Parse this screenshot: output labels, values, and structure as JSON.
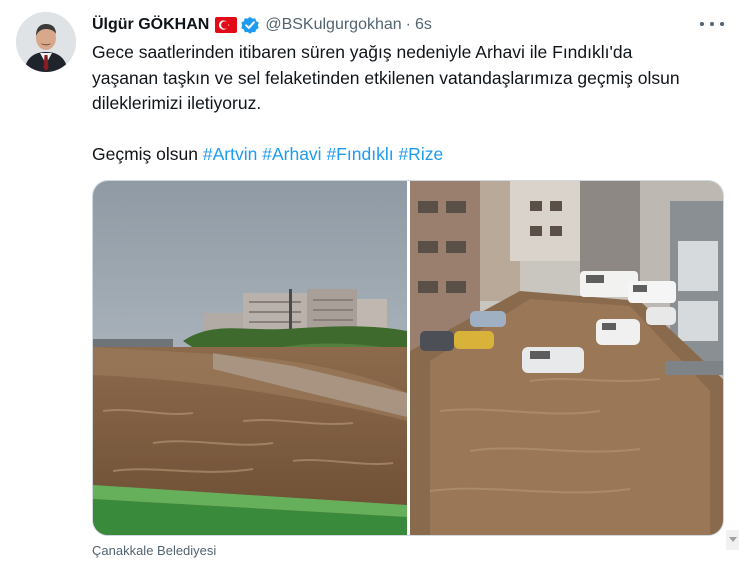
{
  "author": {
    "display_name": "Ülgür GÖKHAN",
    "handle": "@BSKulgurgokhan",
    "separator": "·",
    "time": "6s",
    "flag_icon": "turkey-flag-icon",
    "verified_icon": "verified-badge-icon",
    "avatar_icon": "avatar"
  },
  "tweet": {
    "lines": [
      "Gece saatlerinden itibaren süren yağış nedeniyle Arhavi ile Fındıklı'da",
      "yaşanan taşkın ve sel felaketinden etkilenen vatandaşlarımıza geçmiş olsun",
      "dileklerimizi iletiyoruz."
    ],
    "closing_text": "Geçmiş olsun",
    "hashtags": [
      "#Artvin",
      "#Arhavi",
      "#Fındıklı",
      "#Rize"
    ]
  },
  "media": {
    "count": 2,
    "photos": [
      "flood-river-photo",
      "flooded-street-photo"
    ]
  },
  "source_label": "Çanakkale Belediyesi",
  "colors": {
    "text": "#0f1419",
    "secondary": "#536471",
    "link": "#1d9bf0",
    "verified": "#1d9bf0",
    "flag_red": "#e30a17"
  }
}
